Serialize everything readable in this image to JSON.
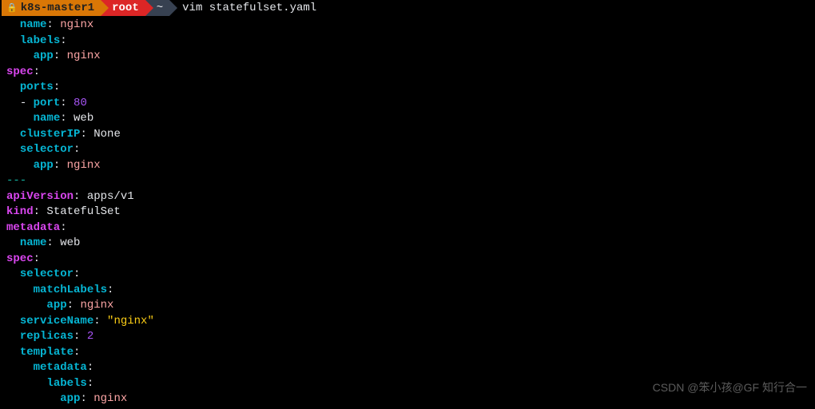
{
  "prompt": {
    "host": "k8s-master1",
    "user": "root",
    "cwd": "~",
    "command": "vim statefulset.yaml"
  },
  "yaml": {
    "svc": {
      "name_key": "name",
      "name_val": "nginx",
      "labels_key": "labels",
      "labels_app_key": "app",
      "labels_app_val": "nginx",
      "spec_key": "spec",
      "ports_key": "ports",
      "port_key": "port",
      "port_val": "80",
      "port_name_key": "name",
      "port_name_val": "web",
      "clusterip_key": "clusterIP",
      "clusterip_val": "None",
      "selector_key": "selector",
      "selector_app_key": "app",
      "selector_app_val": "nginx"
    },
    "sep": "---",
    "sts": {
      "apiversion_key": "apiVersion",
      "apiversion_val": "apps/v1",
      "kind_key": "kind",
      "kind_val": "StatefulSet",
      "metadata_key": "metadata",
      "name_key": "name",
      "name_val": "web",
      "spec_key": "spec",
      "selector_key": "selector",
      "matchlabels_key": "matchLabels",
      "matchlabels_app_key": "app",
      "matchlabels_app_val": "nginx",
      "servicename_key": "serviceName",
      "servicename_val": "\"nginx\"",
      "replicas_key": "replicas",
      "replicas_val": "2",
      "template_key": "template",
      "tmpl_metadata_key": "metadata",
      "tmpl_labels_key": "labels",
      "tmpl_app_key": "app",
      "tmpl_app_val": "nginx"
    }
  },
  "watermark": "CSDN @笨小孩@GF 知行合一"
}
